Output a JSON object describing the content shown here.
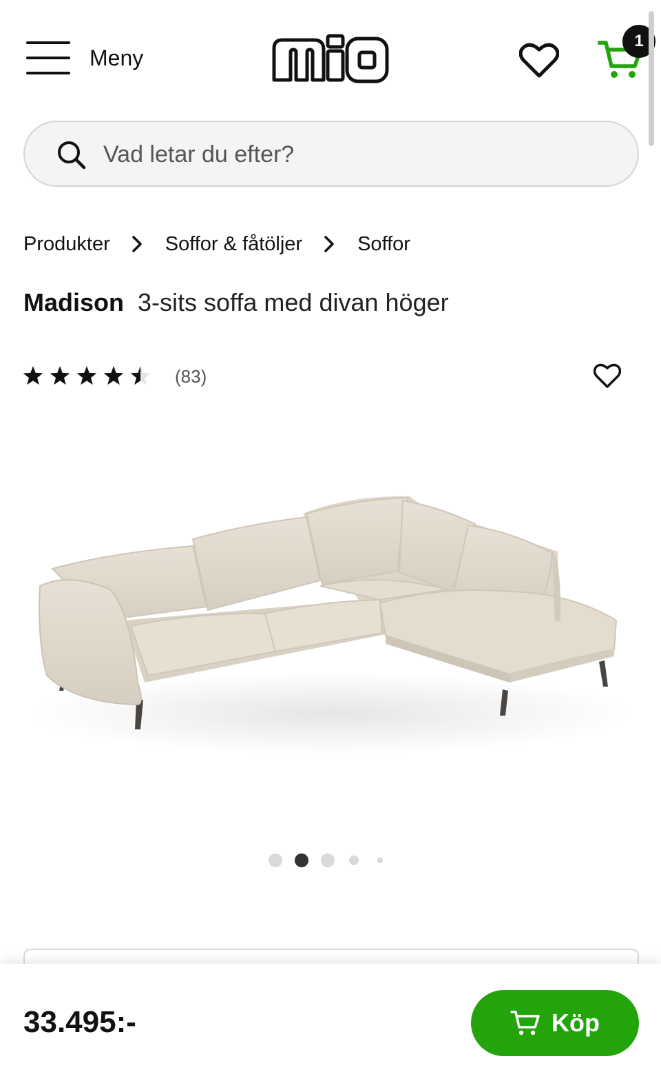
{
  "header": {
    "menu_label": "Meny",
    "logo_text": "mio",
    "cart_count": "1",
    "brand_color": "#22a40a"
  },
  "search": {
    "placeholder": "Vad letar du efter?"
  },
  "breadcrumb": {
    "items": [
      {
        "label": "Produkter"
      },
      {
        "label": "Soffor & fåtöljer"
      },
      {
        "label": "Soffor"
      }
    ]
  },
  "product": {
    "brand": "Madison",
    "description": "3-sits soffa med divan höger",
    "rating": 4.5,
    "rating_max": 5,
    "review_count": "(83)",
    "price": "33.495:-",
    "image_count": 5,
    "active_image": 2
  },
  "actions": {
    "buy_label": "Köp"
  },
  "icons": {
    "menu": "hamburger-icon",
    "favorite": "heart-icon",
    "cart": "cart-icon",
    "search": "search-icon",
    "breadcrumb_separator": "chevron-right-icon",
    "star": "star-icon"
  }
}
